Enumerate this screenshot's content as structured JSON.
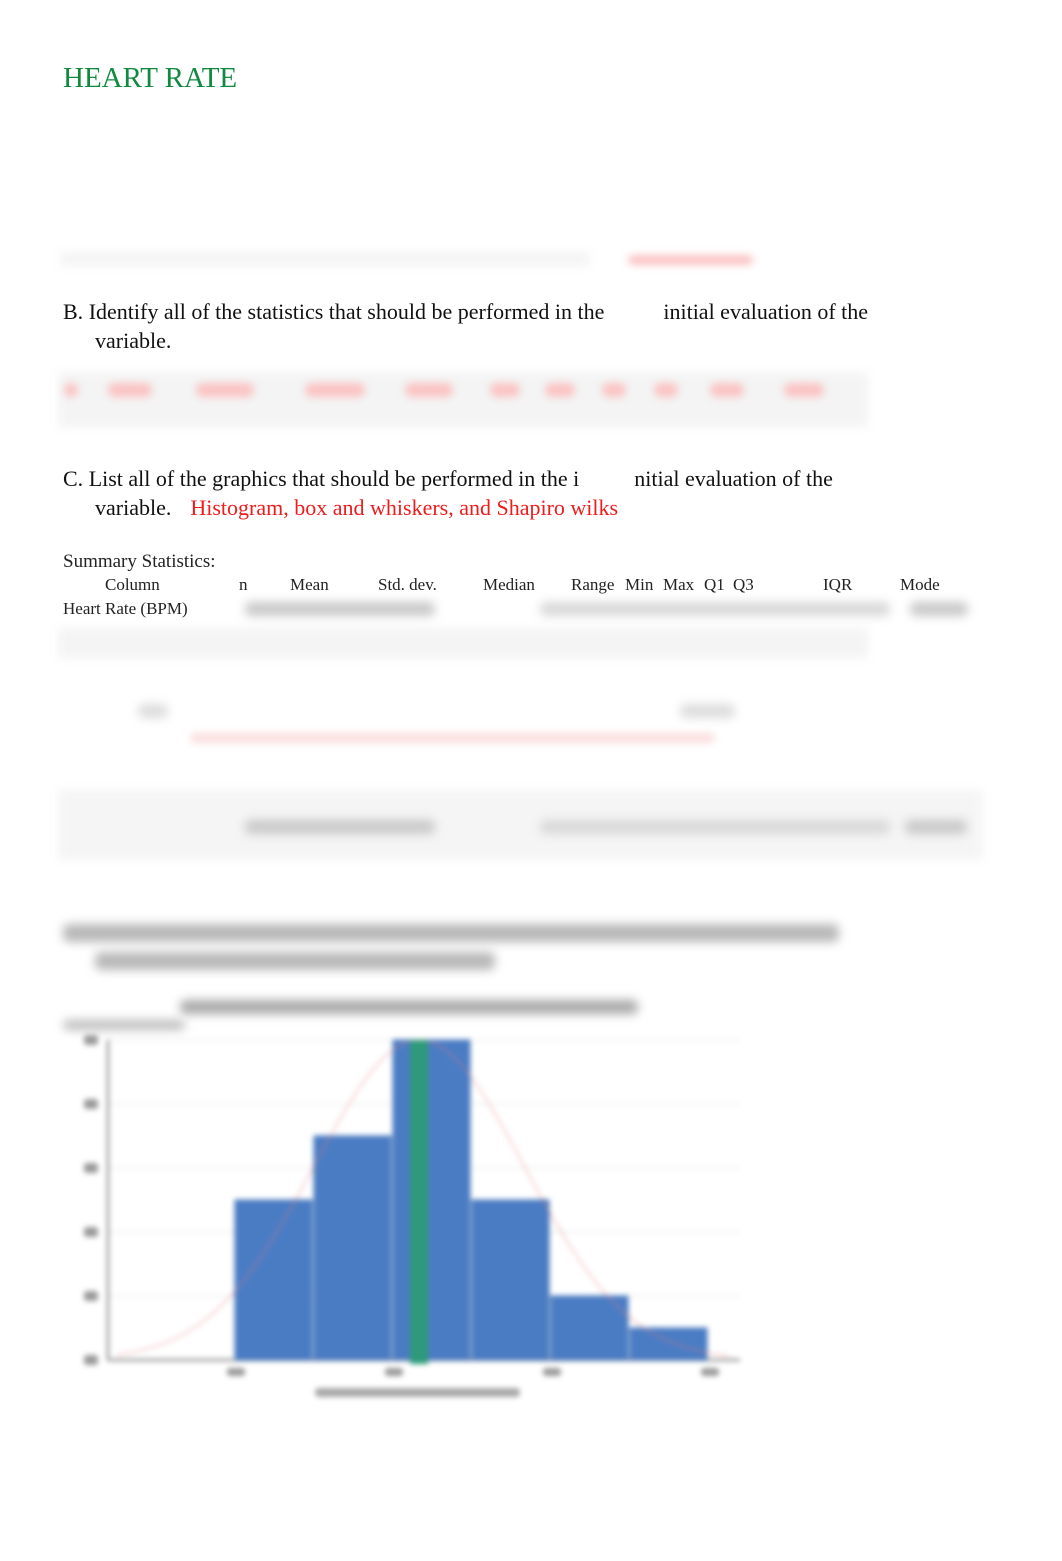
{
  "page": {
    "title": "HEART RATE"
  },
  "section_b": {
    "label": "B.",
    "question_line1a": "Identify",
    "question_line1b": "all of the statistics that should be performed in the",
    "question_line1c": "initial evaluation of the",
    "question_line2": "variable."
  },
  "section_c": {
    "label": "C.",
    "question_line1a": "List",
    "question_line1b": "all of the graphics that should be performed in the i",
    "question_line1c": "nitial evaluation of the",
    "question_line2": "variable.",
    "answer": "Histogram, box and whiskers, and Shapiro wilks",
    "answer_color": "#ee1c1c"
  },
  "summary": {
    "heading": "Summary Statistics:",
    "columns": [
      "Column",
      "n",
      "Mean",
      "Std. dev.",
      "Median",
      "Range",
      "Min",
      "Max",
      "Q1",
      "Q3",
      "IQR",
      "Mode"
    ],
    "rows": [
      {
        "label": "Heart Rate (BPM)"
      }
    ]
  },
  "colors": {
    "title": "#108a3e",
    "bar": "#4a7cc4",
    "mean_line": "#2e9a7a",
    "curve": "#e88080"
  },
  "chart_data": {
    "type": "bar",
    "title": "",
    "xlabel": "",
    "ylabel": "",
    "categories": [
      "bin1",
      "bin2",
      "bin3",
      "bin4",
      "bin5",
      "bin6"
    ],
    "values": [
      5,
      7,
      10,
      5,
      2,
      1
    ],
    "ylim": [
      0,
      10
    ],
    "yticks": [
      0,
      2,
      4,
      6,
      8,
      10
    ],
    "grid": true,
    "mean_marker_bin_fraction": 0.33,
    "legend": "none"
  }
}
